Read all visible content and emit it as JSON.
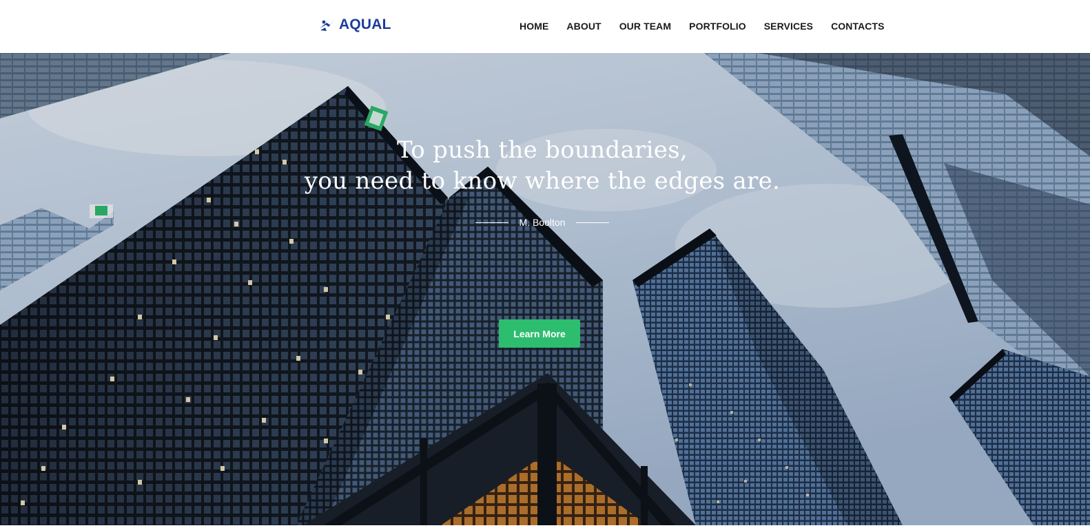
{
  "brand": {
    "name": "AQUAL",
    "color": "#1c3b9a",
    "icon": "swimmer-icon"
  },
  "nav": {
    "items": [
      {
        "label": "HOME"
      },
      {
        "label": "ABOUT"
      },
      {
        "label": "OUR TEAM"
      },
      {
        "label": "PORTFOLIO"
      },
      {
        "label": "SERVICES"
      },
      {
        "label": "CONTACTS"
      }
    ]
  },
  "hero": {
    "quote_line_1": "To push the boundaries,",
    "quote_line_2": "you need to know where the edges are.",
    "author": "M. Boolton",
    "cta_label": "Learn More",
    "cta_color": "#2dbd6e"
  }
}
